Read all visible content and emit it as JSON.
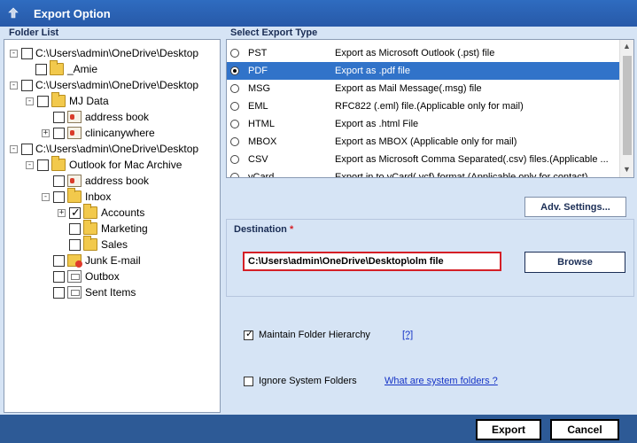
{
  "window": {
    "title": "Export Option"
  },
  "folder_list": {
    "label": "Folder List",
    "items": [
      {
        "label": "C:\\Users\\admin\\OneDrive\\Desktop",
        "type": "root",
        "expander": "-",
        "checked": false
      },
      {
        "label": "_Amie",
        "type": "folder",
        "expander": "",
        "checked": false
      },
      {
        "label": "C:\\Users\\admin\\OneDrive\\Desktop",
        "type": "root",
        "expander": "-",
        "checked": false
      },
      {
        "label": "MJ Data",
        "type": "folder",
        "expander": "-",
        "checked": false
      },
      {
        "label": "address book",
        "type": "contact",
        "expander": "",
        "checked": false
      },
      {
        "label": "clinicanywhere",
        "type": "contact",
        "expander": "+",
        "checked": false
      },
      {
        "label": "C:\\Users\\admin\\OneDrive\\Desktop",
        "type": "root",
        "expander": "-",
        "checked": false
      },
      {
        "label": "Outlook for Mac Archive",
        "type": "folder",
        "expander": "-",
        "checked": false
      },
      {
        "label": "address book",
        "type": "contact",
        "expander": "",
        "checked": false
      },
      {
        "label": "Inbox",
        "type": "folder",
        "expander": "-",
        "checked": false
      },
      {
        "label": "Accounts",
        "type": "folder",
        "expander": "+",
        "checked": true
      },
      {
        "label": "Marketing",
        "type": "folder",
        "expander": "",
        "checked": false
      },
      {
        "label": "Sales",
        "type": "folder",
        "expander": "",
        "checked": false
      },
      {
        "label": "Junk E-mail",
        "type": "junk",
        "expander": "",
        "checked": false
      },
      {
        "label": "Outbox",
        "type": "outbox",
        "expander": "",
        "checked": false
      },
      {
        "label": "Sent Items",
        "type": "outbox",
        "expander": "",
        "checked": false
      }
    ]
  },
  "export_type": {
    "label": "Select Export Type",
    "selected": "PDF",
    "options": [
      {
        "name": "PST",
        "desc": "Export as Microsoft Outlook (.pst) file"
      },
      {
        "name": "PDF",
        "desc": "Export as .pdf file"
      },
      {
        "name": "MSG",
        "desc": "Export as Mail Message(.msg) file"
      },
      {
        "name": "EML",
        "desc": "RFC822 (.eml) file.(Applicable only for mail)"
      },
      {
        "name": "HTML",
        "desc": "Export as .html File"
      },
      {
        "name": "MBOX",
        "desc": "Export as MBOX (Applicable only for mail)"
      },
      {
        "name": "CSV",
        "desc": "Export as Microsoft Comma Separated(.csv) files.(Applicable ..."
      },
      {
        "name": "vCard",
        "desc": "Export in to vCard(.vcf) format (Applicable only for contact)"
      }
    ]
  },
  "adv_settings_label": "Adv. Settings...",
  "destination": {
    "label": "Destination",
    "required_mark": "*",
    "path": "C:\\Users\\admin\\OneDrive\\Desktop\\olm file",
    "browse_label": "Browse"
  },
  "options": {
    "maintain_hierarchy": {
      "label": "Maintain Folder Hierarchy",
      "checked": true,
      "help_link": "[?]"
    },
    "ignore_system": {
      "label": "Ignore System Folders",
      "checked": false,
      "help_link": "What are system folders ?"
    }
  },
  "footer": {
    "export_label": "Export",
    "cancel_label": "Cancel"
  },
  "colors": {
    "accent": "#3173c9",
    "title_bar": "#2b5797",
    "panel": "#d6e4f5",
    "required": "#d51f26"
  }
}
